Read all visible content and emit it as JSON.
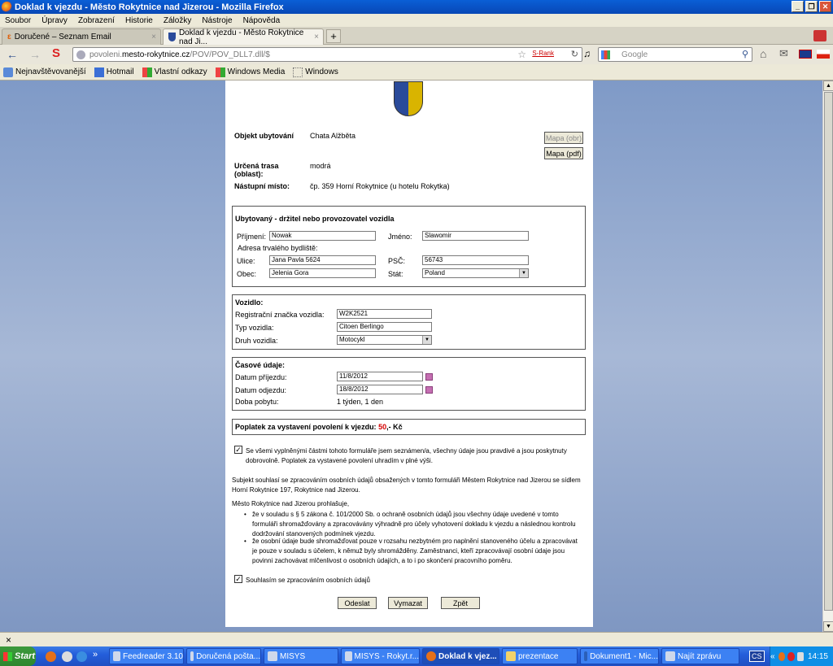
{
  "window": {
    "title": "Doklad k vjezdu - Město Rokytnice nad Jizerou - Mozilla Firefox"
  },
  "menu": [
    "Soubor",
    "Úpravy",
    "Zobrazení",
    "Historie",
    "Záložky",
    "Nástroje",
    "Nápověda"
  ],
  "tabs": [
    {
      "label": "Doručené – Seznam Email"
    },
    {
      "label": "Doklad k vjezdu - Město Rokytnice nad Ji..."
    }
  ],
  "nav": {
    "url_prefix": "povoleni.",
    "url_domain": "mesto-rokytnice.cz",
    "url_path": "/POV/POV_DLL7.dll/$",
    "srank": "S-Rank",
    "search_placeholder": "Google"
  },
  "bookmarks": [
    "Nejnavštěvovanější",
    "Hotmail",
    "Vlastní odkazy",
    "Windows Media",
    "Windows"
  ],
  "form": {
    "objekt_label": "Objekt ubytování",
    "objekt_value": "Chata Alžběta",
    "trasa_label": "Určená trasa (oblast):",
    "trasa_value": "modrá",
    "nastupni_label": "Nástupní místo:",
    "nastupni_value": "čp. 359 Horní Rokytnice (u hotelu Rokytka)",
    "mapa_obr": "Mapa (obr)",
    "mapa_pdf": "Mapa (pdf)",
    "ubytovany": {
      "heading": "Ubytovaný - držitel nebo provozovatel vozidla",
      "prijmeni_label": "Příjmení:",
      "prijmeni_value": "Nowak",
      "jmeno_label": "Jméno:",
      "jmeno_value": "Slawomir",
      "adresa_label": "Adresa trvalého bydliště:",
      "ulice_label": "Ulice:",
      "ulice_value": "Jana Pavla 5624",
      "psc_label": "PSČ:",
      "psc_value": "56743",
      "obec_label": "Obec:",
      "obec_value": "Jelenia Gora",
      "stat_label": "Stát:",
      "stat_value": "Poland"
    },
    "vozidlo": {
      "heading": "Vozidlo:",
      "spz_label": "Registrační značka vozidla:",
      "spz_value": "W2K2521",
      "typ_label": "Typ vozidla:",
      "typ_value": "Citoen Berlingo",
      "druh_label": "Druh vozidla:",
      "druh_value": "Motocykl"
    },
    "casove": {
      "heading": "Časové údaje:",
      "prijezd_label": "Datum příjezdu:",
      "prijezd_value": "11/8/2012",
      "odjezd_label": "Datum odjezdu:",
      "odjezd_value": "18/8/2012",
      "doba_label": "Doba pobytu:",
      "doba_value": "1 týden, 1 den"
    },
    "poplatek": {
      "label": "Poplatek za vystavení povolení k vjezdu:",
      "amount": "50",
      "suffix": ",- Kč"
    },
    "souhlas1": "Se všemi vyplněnými částmi tohoto formuláře jsem seznámen/a, všechny údaje jsou pravdivé a jsou poskytnuty dobrovolně. Poplatek za vystavené povolení uhradím v plné výši.",
    "subjekt": "Subjekt souhlasí se zpracováním osobních údajů obsažených v tomto formuláři Městem Rokytnice nad Jizerou se sídlem Horní Rokytnice 197, Rokytnice nad Jizerou.",
    "prohlasuje": "Město Rokytnice nad Jizerou prohlašuje,",
    "bullet1": "že v souladu s § 5 zákona č. 101/2000 Sb. o ochraně osobních údajů jsou všechny údaje uvedené v tomto formuláři shromažďovány a zpracovávány výhradně pro účely vyhotovení dokladu k vjezdu a následnou kontrolu dodržování stanovených podmínek vjezdu.",
    "bullet2": "že osobní údaje bude shromažďovat pouze v rozsahu nezbytném pro naplnění stanoveného účelu a zpracovávat je pouze v souladu s účelem, k němuž byly shromážděny. Zaměstnanci, kteří zpracovávají osobní údaje jsou povinni zachovávat mlčenlivost o osobních údajích, a to i po skončení pracovního poměru.",
    "souhlas2": "Souhlasím se zpracováním osobních údajů",
    "odeslat": "Odeslat",
    "vymazat": "Vymazat",
    "zpet": "Zpět"
  },
  "taskbar": {
    "start": "Start",
    "items": [
      "Feedreader 3.10",
      "Doručená pošta...",
      "MISYS",
      "MISYS - Rokyt.r...",
      "Doklad k vjez...",
      "prezentace",
      "Dokument1 - Mic...",
      "Najít zprávu"
    ],
    "lang": "CS",
    "clock": "14:15"
  },
  "findbar_close": "×",
  "colors": {
    "title_blue": "#0a5fd6",
    "fee_red": "#d40000",
    "page_bg": "#7f9ac7"
  }
}
